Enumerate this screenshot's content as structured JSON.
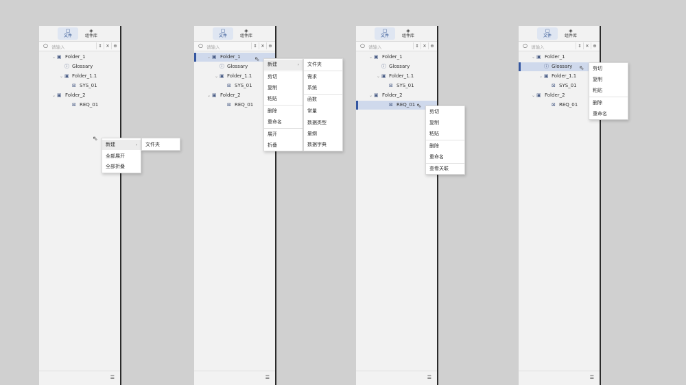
{
  "tabs": {
    "files": "文件",
    "library": "组件库"
  },
  "search": {
    "placeholder": "请输入"
  },
  "tree": {
    "folder1": "Folder_1",
    "glossary": "Glossary",
    "folder11": "Folder_1.1",
    "sys01": "SYS_01",
    "folder2": "Folder_2",
    "req01": "REQ_01"
  },
  "menus": {
    "blank": {
      "new": "新建",
      "expand_all": "全部展开",
      "collapse_all": "全部折叠",
      "sub_folder": "文件夹"
    },
    "folder": {
      "new": "新建",
      "cut": "剪切",
      "copy": "复制",
      "paste": "粘贴",
      "delete": "删除",
      "rename": "重命名",
      "expand": "展开",
      "collapse": "折叠",
      "submenu": [
        "文件夹",
        "需求",
        "系统",
        "函数",
        "常量",
        "数据类型",
        "量纲",
        "数据字典"
      ]
    },
    "item": {
      "cut": "剪切",
      "copy": "复制",
      "paste": "粘贴",
      "delete": "删除",
      "rename": "重命名",
      "view_links": "查看关联"
    },
    "glossary": {
      "cut": "剪切",
      "copy": "复制",
      "paste": "粘贴",
      "delete": "删除",
      "rename": "重命名"
    }
  },
  "icons": [
    "file-icon",
    "library-icon",
    "search-icon",
    "expand-icon",
    "collapse-icon",
    "locate-icon",
    "folder-icon",
    "info-icon",
    "component-icon",
    "settings-icon",
    "cursor-icon",
    "chevron-right-icon"
  ],
  "colors": {
    "selection": "#cfd9ec",
    "selection_bar": "#3456a0",
    "active_tab": "#dfe6f2"
  }
}
